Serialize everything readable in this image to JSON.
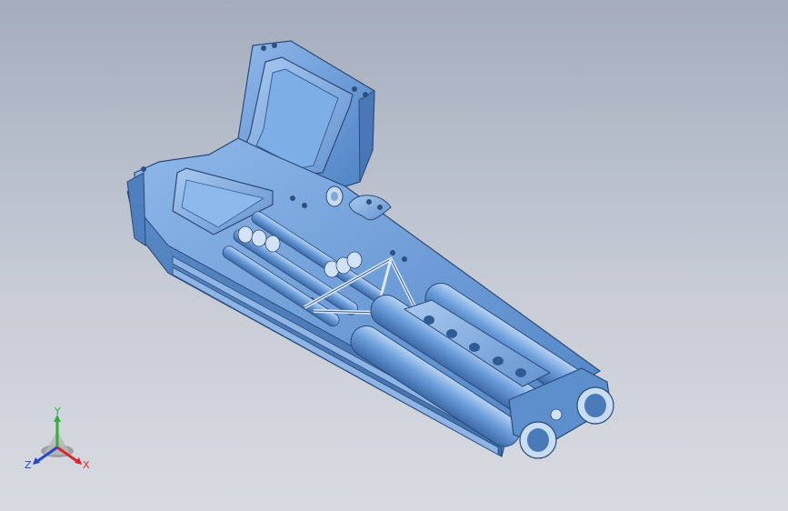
{
  "viewport": {
    "background_top": "#a4adbe",
    "background_bottom": "#d8dbe1",
    "model_color": "#6a9ad6"
  },
  "triad": {
    "x_label": "X",
    "y_label": "Y",
    "z_label": "Z",
    "x_color": "#d9262a",
    "y_color": "#2fae3a",
    "z_color": "#2746c8"
  }
}
